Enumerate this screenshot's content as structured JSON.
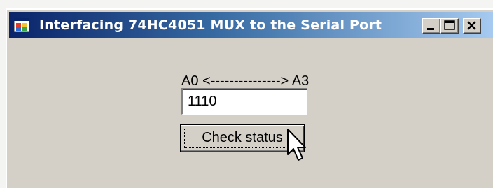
{
  "window": {
    "title": "Interfacing 74HC4051 MUX to the Serial Port"
  },
  "form": {
    "range_label": "A0 <---------------> A3",
    "status_value": "1110",
    "check_button_label": "Check status"
  },
  "icons": {
    "app": "application-icon",
    "minimize": "minimize-icon",
    "maximize": "maximize-icon",
    "close": "close-icon",
    "cursor": "mouse-pointer-icon"
  },
  "colors": {
    "titlebar_start": "#0a246a",
    "titlebar_end": "#a6caf0",
    "window_face": "#d4d0c8"
  }
}
